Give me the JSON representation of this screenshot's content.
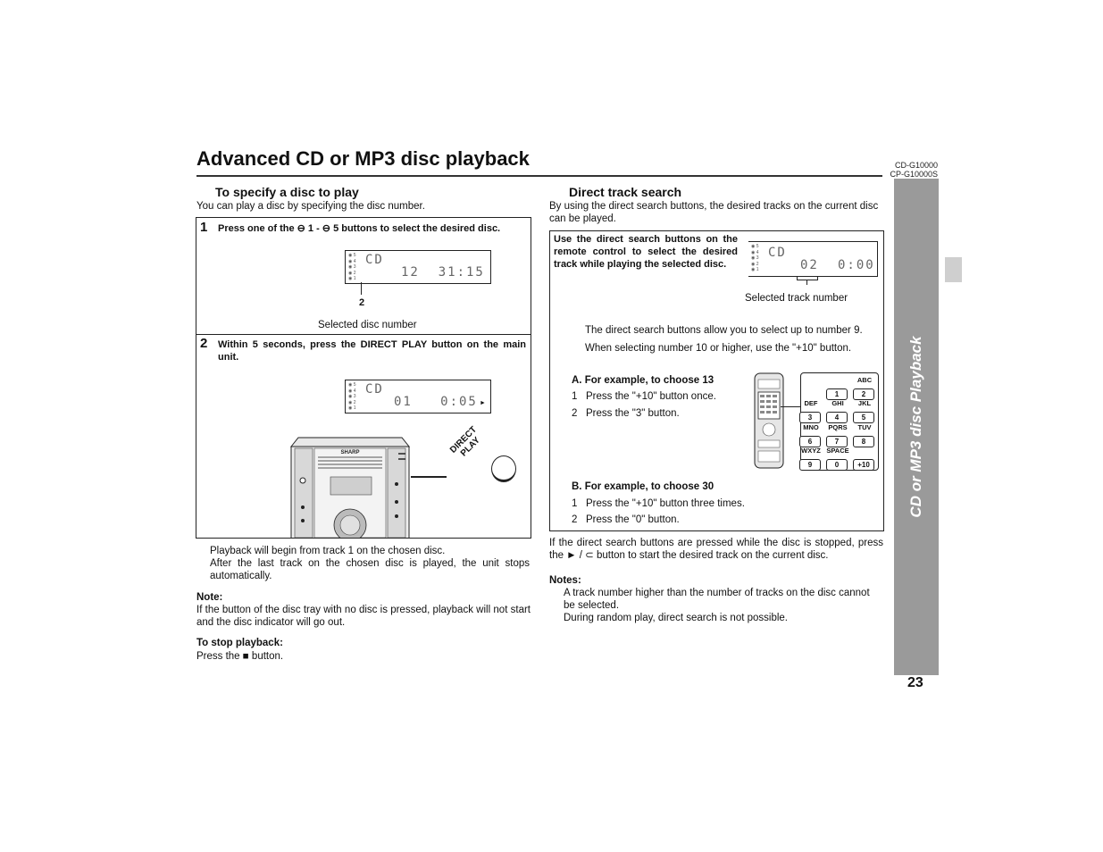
{
  "header": {
    "title": "Advanced CD or MP3 disc playback",
    "models": [
      "CD-G10000",
      "CP-G10000S"
    ]
  },
  "side_tab": {
    "label": "CD or MP3 disc Playback",
    "page_number": "23"
  },
  "left": {
    "heading": "To specify a disc to play",
    "intro": "You can play a disc by specifying the disc number.",
    "step1": {
      "number": "1",
      "text": "Press one of the ⊖ 1 - ⊖ 5 buttons to select the desired disc.",
      "lcd": {
        "mode": "CD",
        "digits": "12  31:15",
        "callout": "2"
      },
      "caption": "Selected disc number"
    },
    "step2": {
      "number": "2",
      "text": "Within 5 seconds, press the DIRECT PLAY button on the main unit.",
      "lcd": {
        "mode": "CD",
        "digits": "01   0:05",
        "play": "►"
      },
      "unit_brand": "SHARP",
      "button_label_1": "DIRECT",
      "button_label_2": "PLAY"
    },
    "bullets": [
      "Playback will begin from track 1 on the chosen disc.",
      "After the last track on the chosen disc is played, the unit stops automatically."
    ],
    "note_heading": "Note:",
    "note_text": "If the button of the disc tray with no disc is pressed, playback will not start and the disc indicator will go out.",
    "stop_heading": "To stop playback:",
    "stop_text_pre": "Press the ",
    "stop_icon": "■",
    "stop_text_post": " button."
  },
  "right": {
    "heading": "Direct track search",
    "intro": "By using the direct search buttons, the desired tracks on the current disc can be played.",
    "box_instruction": "Use the direct search buttons on the remote control to select the desired track while playing the selected disc.",
    "lcd": {
      "mode": "CD",
      "track": "02",
      "time": "0:00"
    },
    "lcd_caption": "Selected track number",
    "info": [
      "The direct search buttons allow you to select up to number 9.",
      "When selecting number 10 or higher, use the \"+10\" button."
    ],
    "example_a": {
      "heading": "A. For example, to choose 13",
      "steps": [
        {
          "n": "1",
          "text": "Press the \"+10\" button once."
        },
        {
          "n": "2",
          "text": "Press the \"3\" button."
        }
      ]
    },
    "example_b": {
      "heading": "B. For example, to choose 30",
      "steps": [
        {
          "n": "1",
          "text": "Press the \"+10\" button three times."
        },
        {
          "n": "2",
          "text": "Press the \"0\" button."
        }
      ]
    },
    "keypad": {
      "rows": [
        {
          "labels": [
            "",
            "",
            "ABC"
          ],
          "keys": [
            "",
            "1",
            "2"
          ]
        },
        {
          "labels": [
            "DEF",
            "GHI",
            "JKL"
          ],
          "keys": [
            "3",
            "4",
            "5"
          ]
        },
        {
          "labels": [
            "MNO",
            "PQRS",
            "TUV"
          ],
          "keys": [
            "6",
            "7",
            "8"
          ]
        },
        {
          "labels": [
            "WXYZ",
            "SPACE",
            ""
          ],
          "keys": [
            "9",
            "0",
            "+10"
          ]
        }
      ]
    },
    "after_text_1": "If the direct search buttons are pressed while the disc is stopped, press the ► / ⊂ button to start the desired track on the current disc.",
    "notes_heading": "Notes:",
    "notes": [
      "A track number higher than the number of tracks on the disc cannot be selected.",
      "During random play, direct search is not possible."
    ]
  }
}
